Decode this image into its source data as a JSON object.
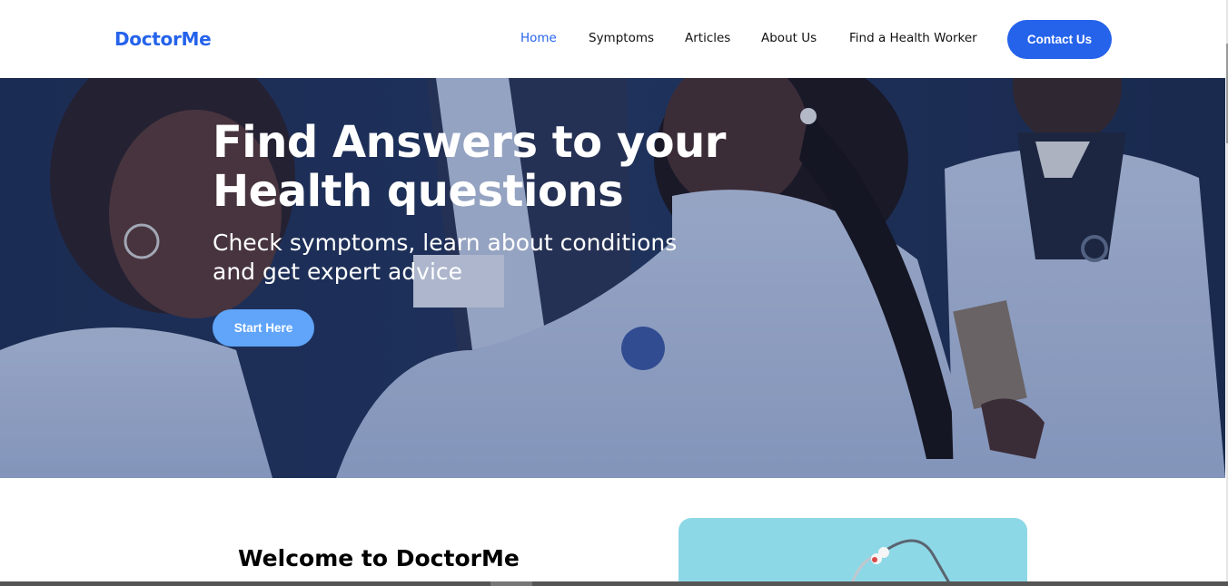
{
  "brand": {
    "name": "DoctorMe",
    "color": "#2563eb"
  },
  "nav": {
    "items": [
      {
        "label": "Home",
        "active": true
      },
      {
        "label": "Symptoms",
        "active": false
      },
      {
        "label": "Articles",
        "active": false
      },
      {
        "label": "About Us",
        "active": false
      },
      {
        "label": "Find a Health Worker",
        "active": false
      }
    ],
    "contact_label": "Contact Us"
  },
  "hero": {
    "title": "Find Answers to your Health questions",
    "subtitle": "Check symptoms, learn about conditions and get expert advice",
    "cta_label": "Start Here",
    "image": "photo of doctors in white coats examining a patient"
  },
  "welcome": {
    "heading": "Welcome to DoctorMe",
    "image": "stethoscope-on-light-blue-background"
  },
  "colors": {
    "accent": "#2563eb",
    "cta": "#60a5fa",
    "card": "#8dd8e6"
  }
}
